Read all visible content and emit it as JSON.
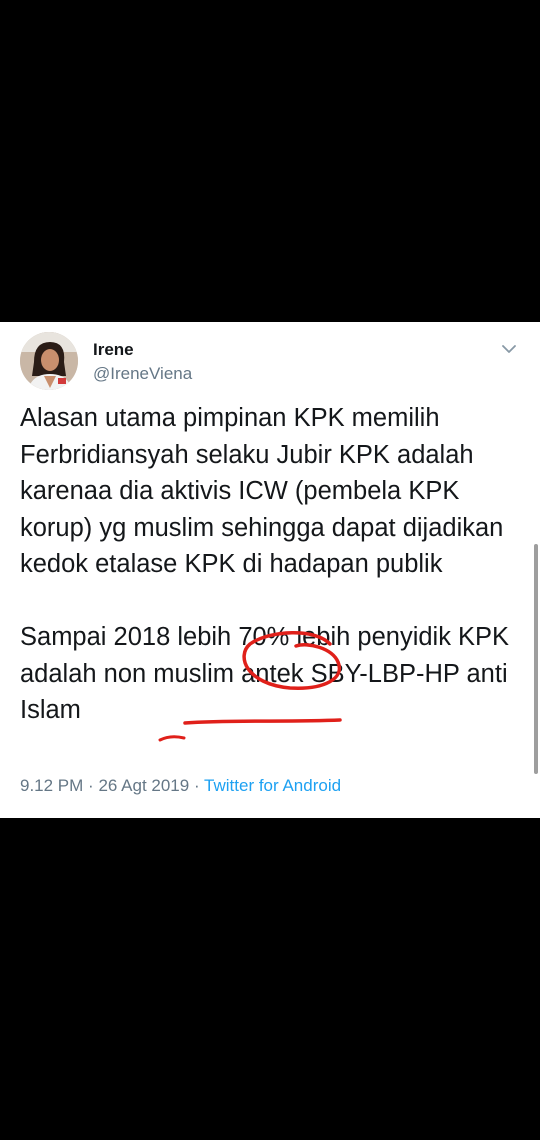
{
  "tweet": {
    "display_name": "Irene",
    "handle": "@IreneViena",
    "text": "Alasan utama pimpinan KPK memilih Ferbridiansyah selaku Jubir KPK adalah karenaa dia aktivis ICW (pembela KPK korup) yg muslim sehingga dapat dijadikan kedok etalase KPK di hadapan publik\n\nSampai 2018 lebih 70% lebih penyidik KPK adalah non muslim antek SBY-LBP-HP anti Islam",
    "time": "9.12 PM",
    "separator_1": "·",
    "date": "26 Agt 2019",
    "separator_2": "·",
    "source": "Twitter for Android"
  },
  "icons": {
    "avatar": "profile-photo",
    "menu": "chevron-down-icon"
  },
  "colors": {
    "background": "#000000",
    "card": "#ffffff",
    "text": "#14171a",
    "secondary_text": "#657786",
    "link": "#1da1f2",
    "annotation": "#e0201a"
  }
}
